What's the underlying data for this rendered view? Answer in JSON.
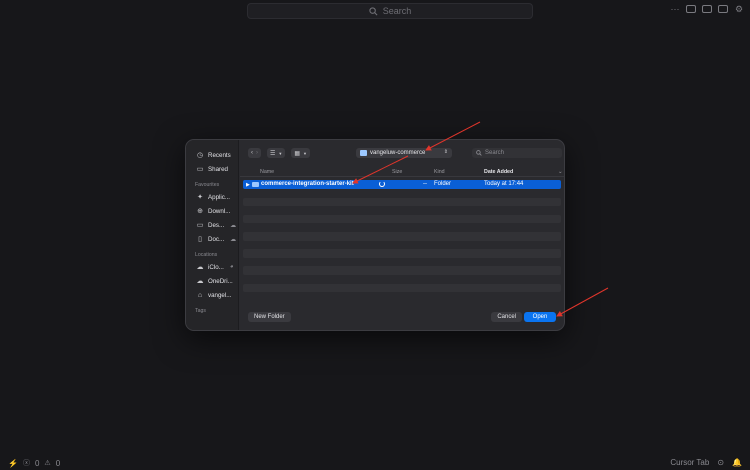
{
  "topbar": {
    "search_placeholder": "Search"
  },
  "statusbar": {
    "errors": "0",
    "warnings": "0",
    "cursor_tab": "Cursor Tab"
  },
  "dialog": {
    "sidebar": {
      "items_top": [
        {
          "label": "Recents",
          "icon": "clock-icon"
        },
        {
          "label": "Shared",
          "icon": "shared-folder-icon"
        }
      ],
      "favourites_heading": "Favourites",
      "favourites": [
        {
          "label": "Applic...",
          "icon": "applications-icon"
        },
        {
          "label": "Downl...",
          "icon": "download-icon"
        },
        {
          "label": "Des...",
          "icon": "desktop-icon"
        },
        {
          "label": "Doc...",
          "icon": "document-icon"
        }
      ],
      "locations_heading": "Locations",
      "locations": [
        {
          "label": "iClo...",
          "icon": "icloud-icon"
        },
        {
          "label": "OneDri...",
          "icon": "onedrive-icon"
        },
        {
          "label": "vangel...",
          "icon": "home-icon"
        }
      ],
      "tags_heading": "Tags"
    },
    "toolbar": {
      "folder": "vangeluw-commerce",
      "search_placeholder": "Search"
    },
    "columns": {
      "name": "Name",
      "size": "Size",
      "kind": "Kind",
      "date": "Date Added"
    },
    "files": [
      {
        "name": "commerce-integration-starter-kit",
        "size": "--",
        "kind": "Folder",
        "date": "Today at 17:44"
      }
    ],
    "buttons": {
      "new_folder": "New Folder",
      "cancel": "Cancel",
      "open": "Open"
    }
  },
  "colors": {
    "accent": "#0a74f0",
    "selection": "#0a5fd6",
    "annotation": "#e0352b"
  }
}
